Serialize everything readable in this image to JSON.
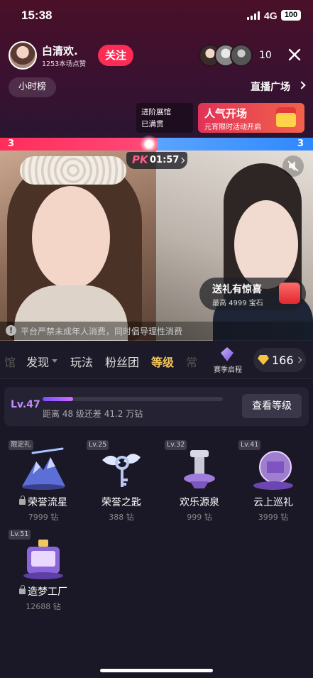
{
  "status_bar": {
    "time": "15:38",
    "network": "4G",
    "battery": "100"
  },
  "host": {
    "name": "白清欢.",
    "likes": "1253本场点赞",
    "follow_label": "关注"
  },
  "viewers": {
    "count": "10"
  },
  "nav": {
    "hour_rank": "小时榜",
    "plaza": "直播广场"
  },
  "promo": {
    "advance_line1": "进阶展馆",
    "advance_line2": "已满贯",
    "banner_title": "人气开场",
    "banner_sub": "元宵限时活动开启"
  },
  "pk": {
    "left_score": "3",
    "right_score": "3",
    "timer": "01:57",
    "logo": "PK"
  },
  "gift_bubble": {
    "title": "送礼有惊喜",
    "sub": "最高 4999 宝石"
  },
  "notice": {
    "text": "平台严禁未成年人消费，同时倡导理性消费"
  },
  "tabs": [
    {
      "label": "馆"
    },
    {
      "label": "发现"
    },
    {
      "label": "玩法"
    },
    {
      "label": "粉丝团"
    },
    {
      "label": "等级"
    },
    {
      "label": "常"
    }
  ],
  "season": {
    "label": "赛季启程"
  },
  "diamonds": {
    "count": "166"
  },
  "level": {
    "current": "Lv.47",
    "progress_fraction": 0.17,
    "gap_text": "距离 48 级还差 41.2 万钻",
    "button": "查看等级"
  },
  "gifts": [
    {
      "badge": "限定礼",
      "name": "荣誉流星",
      "price": "7999 钻",
      "locked": true
    },
    {
      "badge": "Lv.25",
      "name": "荣誉之匙",
      "price": "388 钻",
      "locked": false
    },
    {
      "badge": "Lv.32",
      "name": "欢乐源泉",
      "price": "999 钻",
      "locked": false
    },
    {
      "badge": "Lv.41",
      "name": "云上巡礼",
      "price": "3999 钻",
      "locked": false
    },
    {
      "badge": "Lv.51",
      "name": "造梦工厂",
      "price": "12688 钻",
      "locked": true
    }
  ],
  "colors": {
    "accent_gold": "#f4c75a",
    "follow_red": "#fe2c55",
    "pk_red": "#ff2d5a",
    "pk_blue": "#2f87ff",
    "level_purple": "#c08cff"
  }
}
